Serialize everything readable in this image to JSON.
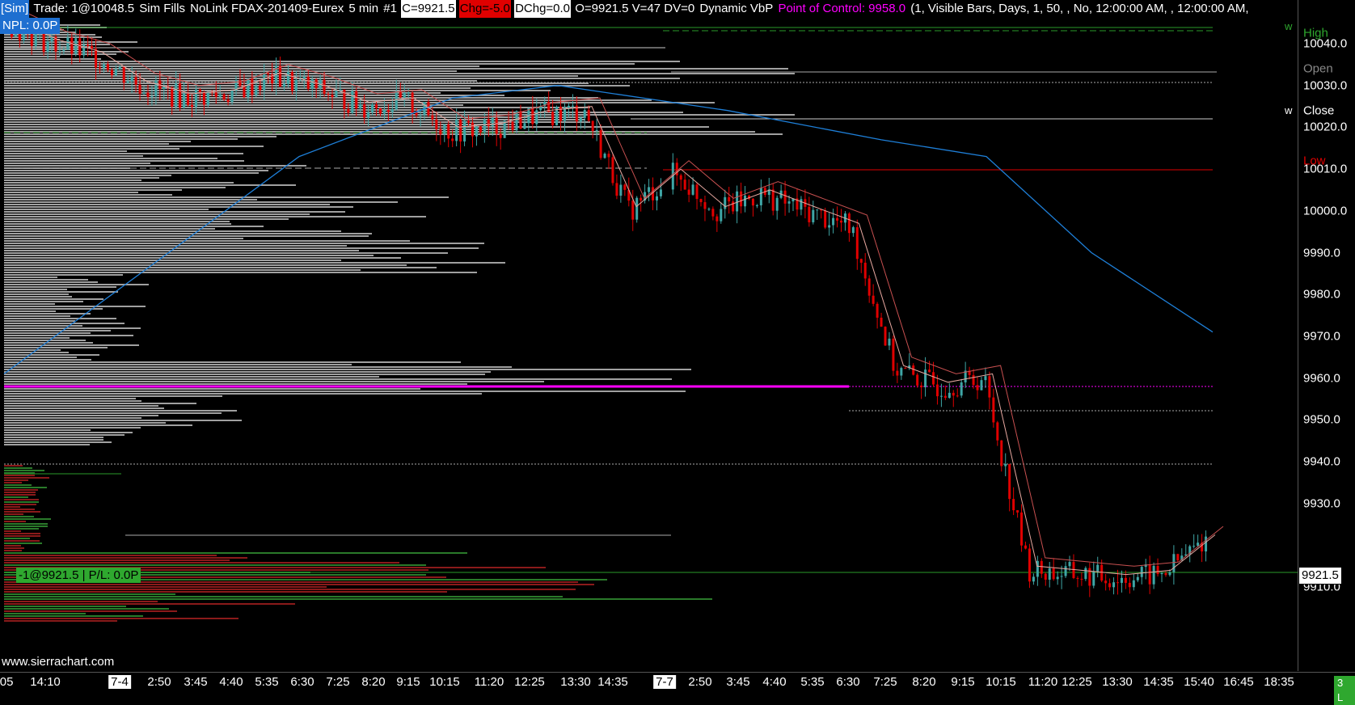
{
  "header": {
    "account": "[Sim]",
    "trade": "Trade: 1@10048.5",
    "fills": "Sim Fills",
    "symbol": "NoLink FDAX-201409-Eurex",
    "interval": "5 min",
    "chart_num": "#1",
    "close": "C=9921.5",
    "change": "Chg=-5.0",
    "dchange": "DChg=0.0",
    "ohlc": "O=9921.5 V=47 DV=0",
    "study": "Dynamic VbP",
    "poc": "Point of Control: 9958.0",
    "params": "(1, Visible Bars, Days, 1, 50, , No, 12:00:00 AM, , 12:00:00 AM,",
    "npl": "NPL: 0.0P"
  },
  "watermark": "www.sierrachart.com",
  "position_label": "-1@9921.5 | P/L: 0.0P",
  "current_price": "9921.5",
  "corner_badge": "3 L",
  "price_axis": {
    "labels": [
      "10040.0",
      "10030.0",
      "10020.0",
      "10010.0",
      "10000.0",
      "9990.0",
      "9980.0",
      "9970.0",
      "9960.0",
      "9950.0",
      "9940.0",
      "9930.0",
      "9910.0"
    ],
    "values": [
      10040,
      10030,
      10020,
      10010,
      10000,
      9990,
      9980,
      9970,
      9960,
      9950,
      9940,
      9930,
      9910
    ],
    "markers": [
      {
        "text": "High",
        "value": 10042.5,
        "color": "#2ea82e"
      },
      {
        "text": "Open",
        "value": 10034,
        "color": "#888888"
      },
      {
        "text": "Close",
        "value": 10024,
        "color": "#ffffff"
      },
      {
        "text": "Low",
        "value": 10012,
        "color": "#e00000"
      }
    ],
    "w_marks": [
      {
        "text": "w",
        "value": 10044,
        "color": "#2ea82e"
      },
      {
        "text": "w",
        "value": 10024,
        "color": "#ffffff"
      }
    ]
  },
  "time_axis": {
    "labels": [
      ":05",
      "14:10",
      "7-4",
      "2:50",
      "3:45",
      "4:40",
      "5:35",
      "6:30",
      "7:25",
      "8:20",
      "9:15",
      "10:15",
      "11:20",
      "12:25",
      "13:30",
      "14:35",
      "7-7",
      "2:50",
      "3:45",
      "4:40",
      "5:35",
      "6:30",
      "7:25",
      "8:20",
      "9:15",
      "10:15",
      "11:20",
      "12:25",
      "13:30",
      "14:35",
      "15:40",
      "16:45",
      "18:35"
    ],
    "dates": [
      "7-4",
      "7-7"
    ]
  },
  "colors": {
    "poc": "#ff00ff",
    "ma_slow": "#1e7fd8",
    "up_bar": "#3fa6a6",
    "down_bar": "#e00000",
    "profile": "#a0a0a0"
  },
  "chart_data": {
    "type": "candlestick",
    "title": "",
    "symbol": "FDAX-201409-Eurex",
    "interval": "5 min",
    "y_range": [
      9900,
      10050
    ],
    "close_path": [
      [
        "7-4 14:10",
        10045
      ],
      [
        "7-4 2:50",
        10040
      ],
      [
        "7-4 3:45",
        10037
      ],
      [
        "7-4 4:40",
        10030
      ],
      [
        "7-4 5:35",
        10027
      ],
      [
        "7-4 6:30",
        10028
      ],
      [
        "7-4 7:25",
        10032
      ],
      [
        "7-4 8:20",
        10029
      ],
      [
        "7-4 9:15",
        10025
      ],
      [
        "7-4 10:15",
        10026
      ],
      [
        "7-4 11:20",
        10019
      ],
      [
        "7-4 12:25",
        10020
      ],
      [
        "7-4 13:30",
        10023
      ],
      [
        "7-4 14:35",
        10024
      ],
      [
        "7-7 2:50",
        10000
      ],
      [
        "7-7 3:45",
        10009
      ],
      [
        "7-7 4:40",
        10000
      ],
      [
        "7-7 5:35",
        10004
      ],
      [
        "7-7 6:30",
        10000
      ],
      [
        "7-7 7:25",
        9996
      ],
      [
        "7-7 8:20",
        9962
      ],
      [
        "7-7 9:15",
        9958
      ],
      [
        "7-7 10:15",
        9960
      ],
      [
        "7-7 11:20",
        9914
      ],
      [
        "7-7 12:25",
        9913
      ],
      [
        "7-7 13:30",
        9912
      ],
      [
        "7-7 14:35",
        9913
      ],
      [
        "7-7 15:40",
        9921.5
      ]
    ],
    "ma_slow": [
      [
        "7-4 :05",
        9961
      ],
      [
        "7-4 6:30",
        10013
      ],
      [
        "7-4 11:20",
        10027
      ],
      [
        "7-4 13:30",
        10030
      ],
      [
        "7-7 3:45",
        10024
      ],
      [
        "7-7 8:20",
        10017
      ],
      [
        "7-7 10:15",
        10013
      ],
      [
        "7-7 13:30",
        9990
      ],
      [
        "7-7 16:45",
        9971
      ]
    ],
    "volume_profile_poc": 9958.0,
    "session_levels": {
      "high": 10042.5,
      "open": 10034,
      "close": 10024,
      "low": 10012
    },
    "trade": {
      "side": "-1",
      "price": 9921.5,
      "pl": "0.0P"
    }
  }
}
